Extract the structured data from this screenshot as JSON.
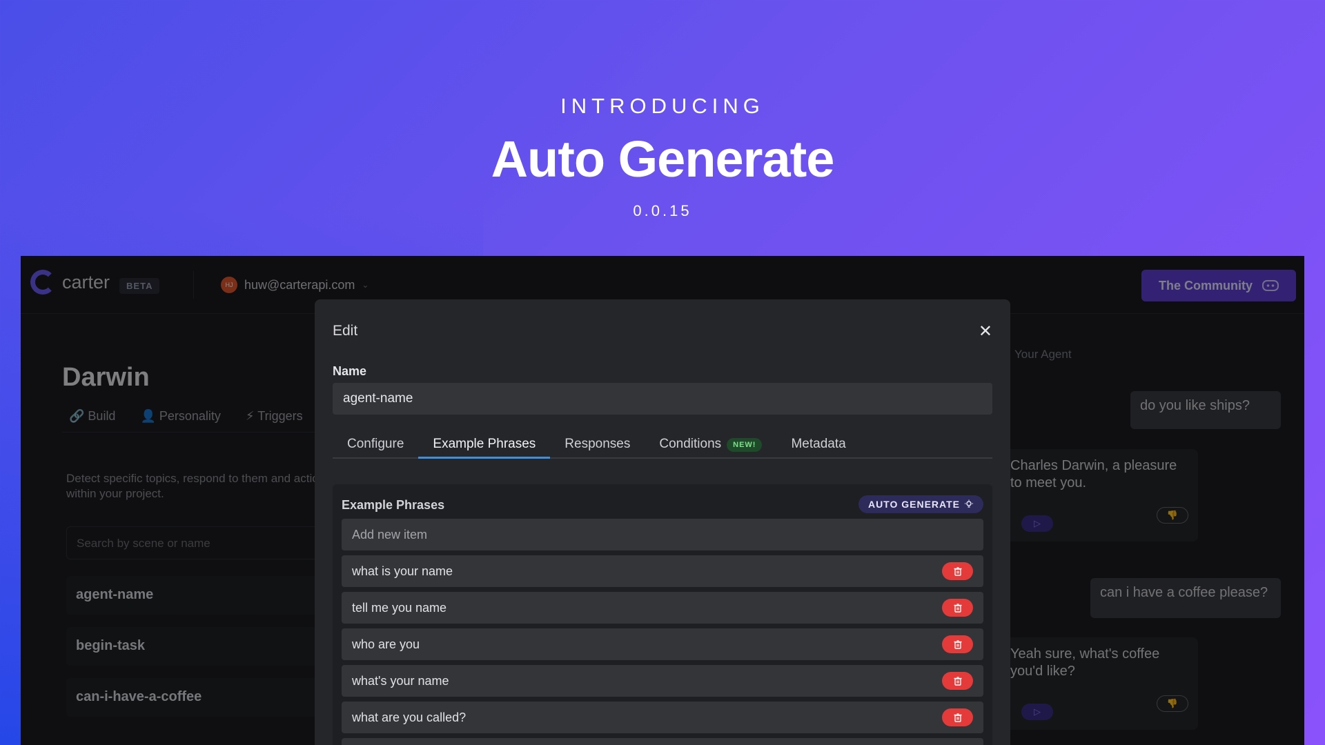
{
  "hero": {
    "kicker": "INTRODUCING",
    "title": "Auto Generate",
    "version": "0.0.15"
  },
  "app": {
    "logo_text": "carter",
    "beta_label": "BETA",
    "account_email": "huw@carterapi.com",
    "avatar_initials": "HJ",
    "community_button": "The Community",
    "agent_title": "Darwin",
    "side_tabs": [
      "Build",
      "Personality",
      "Triggers"
    ],
    "side_description": "Detect specific topics, respond to them and actions within your project.",
    "search_placeholder": "Search by scene or name",
    "triggers": [
      "agent-name",
      "begin-task",
      "can-i-have-a-coffee"
    ],
    "right_label": "Your Agent",
    "chat": {
      "user_1": "do you like ships?",
      "bot_1": "Charles Darwin, a pleasure to meet you.",
      "user_2": "can i have a coffee please?",
      "bot_2": "Yeah sure, what's coffee you'd like?"
    }
  },
  "modal": {
    "title": "Edit",
    "name_label": "Name",
    "name_value": "agent-name",
    "tabs": {
      "configure": "Configure",
      "example_phrases": "Example Phrases",
      "responses": "Responses",
      "conditions": "Conditions",
      "conditions_badge": "NEW!",
      "metadata": "Metadata"
    },
    "section_title": "Example Phrases",
    "auto_generate_label": "AUTO GENERATE",
    "add_placeholder": "Add new item",
    "phrases": [
      "what is your name",
      "tell me you name",
      "who are you",
      "what's your name",
      "what are you called?"
    ]
  },
  "colors": {
    "accent": "#3d8fe0",
    "delete": "#e53a3a",
    "brand": "#6b5cf6"
  }
}
